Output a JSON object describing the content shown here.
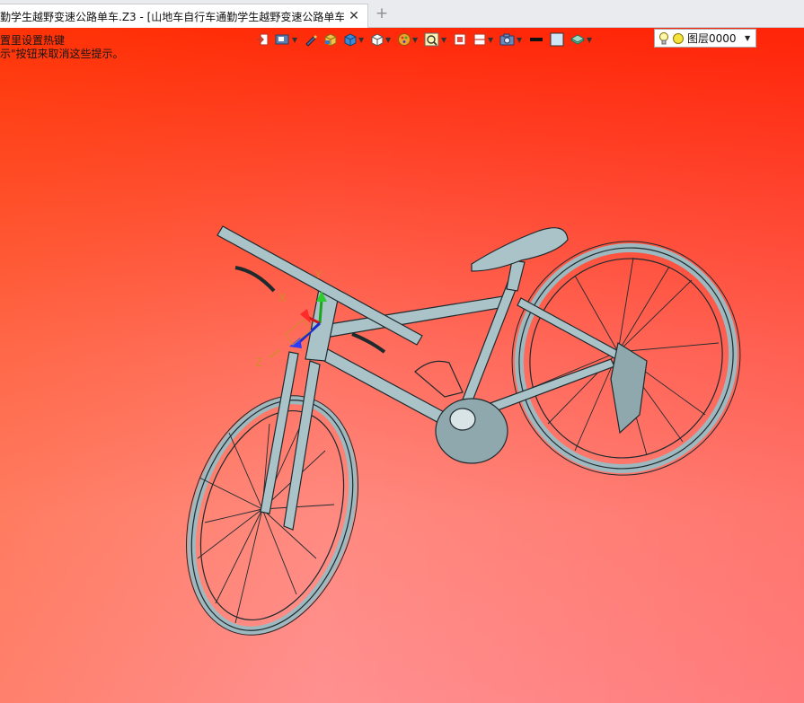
{
  "tab": {
    "title": "勤学生越野变速公路单车.Z3 - [山地车自行车通勤学生越野变速公路单车]",
    "close_glyph": "✕",
    "add_glyph": "+"
  },
  "hints": {
    "line1": "置里设置热键",
    "line2": "示\"按钮来取消这些提示。"
  },
  "toolbar": {
    "layer_name": "图层0000",
    "icons": [
      "exit-icon",
      "view-display-icon",
      "pen-icon",
      "box-yellow-icon",
      "box-blue-icon",
      "box-white-icon",
      "palette-icon",
      "zoom-icon",
      "fit-view-icon",
      "section-icon",
      "camera-icon",
      "line-color-icon",
      "fill-color-icon",
      "layer-stack-icon",
      "light-bulb-icon",
      "layer-status-icon"
    ]
  },
  "axes": {
    "x": "X",
    "y": "Y",
    "z": "Z"
  },
  "colors": {
    "tab_bg": "#e9ebee",
    "viewport_top": "#ff2a08",
    "viewport_bottom": "#ff9090",
    "bike_body": "#a9c3c8",
    "bike_outline": "#1f2a2e"
  }
}
